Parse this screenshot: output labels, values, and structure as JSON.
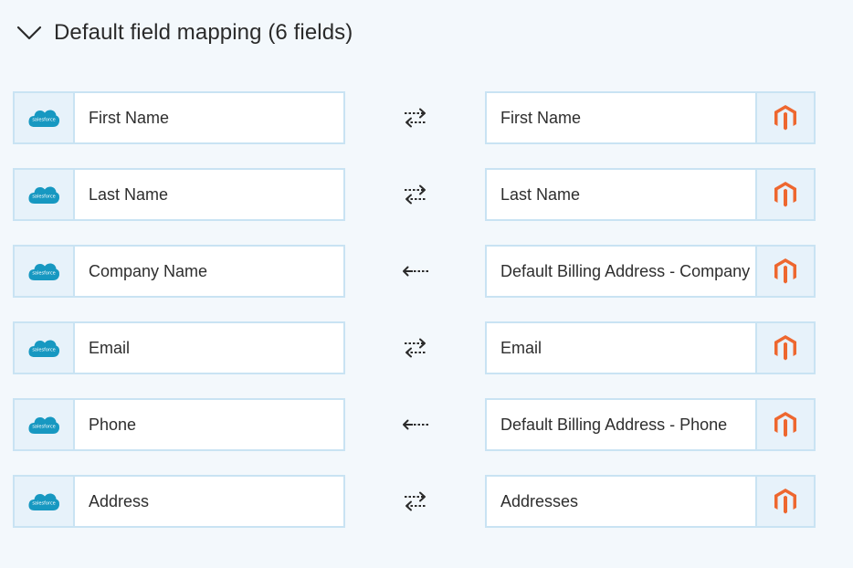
{
  "section": {
    "title": "Default field mapping (6 fields)",
    "expanded": true
  },
  "mappings": [
    {
      "left": "First Name",
      "right": "First Name",
      "direction": "bidirectional"
    },
    {
      "left": "Last Name",
      "right": "Last Name",
      "direction": "bidirectional"
    },
    {
      "left": "Company Name",
      "right": "Default Billing Address - Company",
      "direction": "right-to-left"
    },
    {
      "left": "Email",
      "right": "Email",
      "direction": "bidirectional"
    },
    {
      "left": "Phone",
      "right": "Default Billing Address - Phone",
      "direction": "right-to-left"
    },
    {
      "left": "Address",
      "right": "Addresses",
      "direction": "bidirectional"
    }
  ],
  "left_app": {
    "icon": "salesforce-logo-icon",
    "logo_text": "salesforce",
    "color": "#1798c1"
  },
  "right_app": {
    "icon": "magento-logo-icon",
    "color": "#ee672f"
  }
}
